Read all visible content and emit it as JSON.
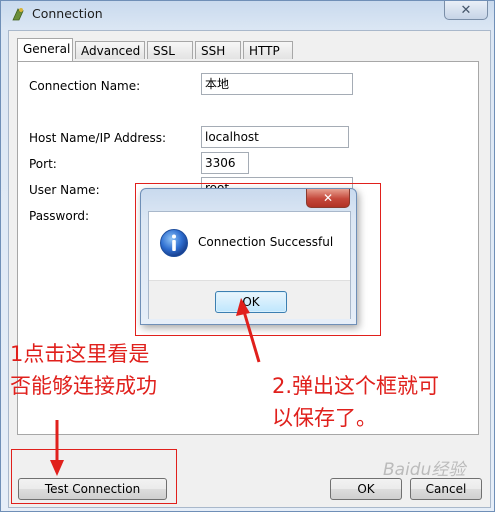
{
  "window": {
    "title": "Connection",
    "close_symbol": "✕"
  },
  "tabs": [
    "General",
    "Advanced",
    "SSL",
    "SSH",
    "HTTP"
  ],
  "form": {
    "connection_name_label": "Connection Name:",
    "connection_name_value": "本地",
    "host_label": "Host Name/IP Address:",
    "host_value": "localhost",
    "port_label": "Port:",
    "port_value": "3306",
    "user_label": "User Name:",
    "user_value": "root",
    "password_label": "Password:",
    "password_value": "•••••"
  },
  "buttons": {
    "test": "Test Connection",
    "ok": "OK",
    "cancel": "Cancel"
  },
  "dialog": {
    "message": "Connection Successful",
    "ok": "OK",
    "close_symbol": "✕"
  },
  "annotations": {
    "left_line1": "1点击这里看是",
    "left_line2": "否能够连接成功",
    "right_line1": "2.弹出这个框就可",
    "right_line2": "以保存了。",
    "color": "#e0201c"
  },
  "watermark": "Baidu经验"
}
